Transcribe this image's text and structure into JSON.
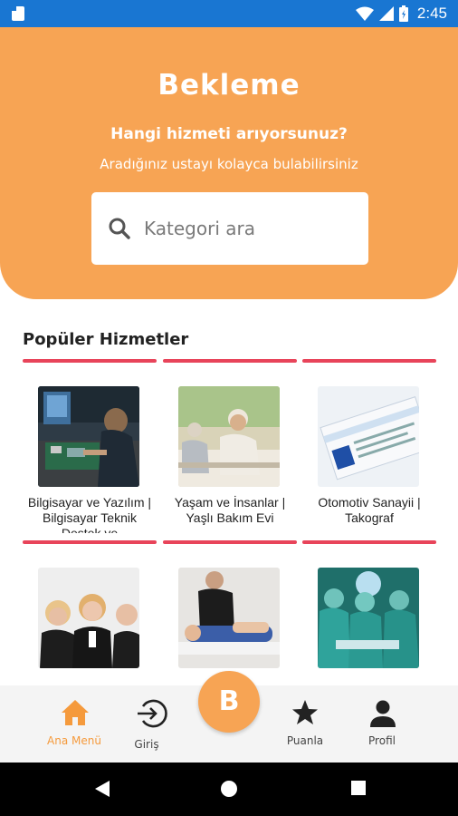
{
  "status_bar": {
    "time": "2:45",
    "bg_color": "#1976d2",
    "icons": [
      "sd-card-icon",
      "wifi-icon",
      "signal-icon",
      "battery-icon"
    ]
  },
  "header": {
    "brand": "Bekleme",
    "subtitle": "Hangi hizmeti arıyorsunuz?",
    "tagline": "Aradığınız ustayı kolayca bulabilirsiniz",
    "bg_color": "#f7a454"
  },
  "search": {
    "placeholder": "Kategori ara",
    "value": ""
  },
  "popular": {
    "title": "Popüler Hizmetler",
    "accent_color": "#e8445a",
    "items": [
      {
        "label": "Bilgisayar ve Yazılım | Bilgisayar Teknik Destek ve",
        "image": "computer-repair-photo"
      },
      {
        "label": "Yaşam ve İnsanlar | Yaşlı Bakım Evi",
        "image": "elderly-care-photo"
      },
      {
        "label": "Otomotiv Sanayii | Takograf",
        "image": "tachograph-photo"
      },
      {
        "label": "",
        "image": "call-center-photo"
      },
      {
        "label": "",
        "image": "physiotherapy-photo"
      },
      {
        "label": "",
        "image": "surgery-photo"
      }
    ]
  },
  "bottom_nav": {
    "items": [
      {
        "label": "Ana Menü",
        "icon": "home-icon",
        "active": true
      },
      {
        "label": "Giriş",
        "icon": "login-icon",
        "active": false
      },
      {
        "label": "Puanla",
        "icon": "star-icon",
        "active": false
      },
      {
        "label": "Profil",
        "icon": "person-icon",
        "active": false
      }
    ],
    "fab_label": "B",
    "active_color": "#f59a3c"
  },
  "system_nav": {
    "icons": [
      "back-icon",
      "home-circle-icon",
      "recents-icon"
    ]
  }
}
